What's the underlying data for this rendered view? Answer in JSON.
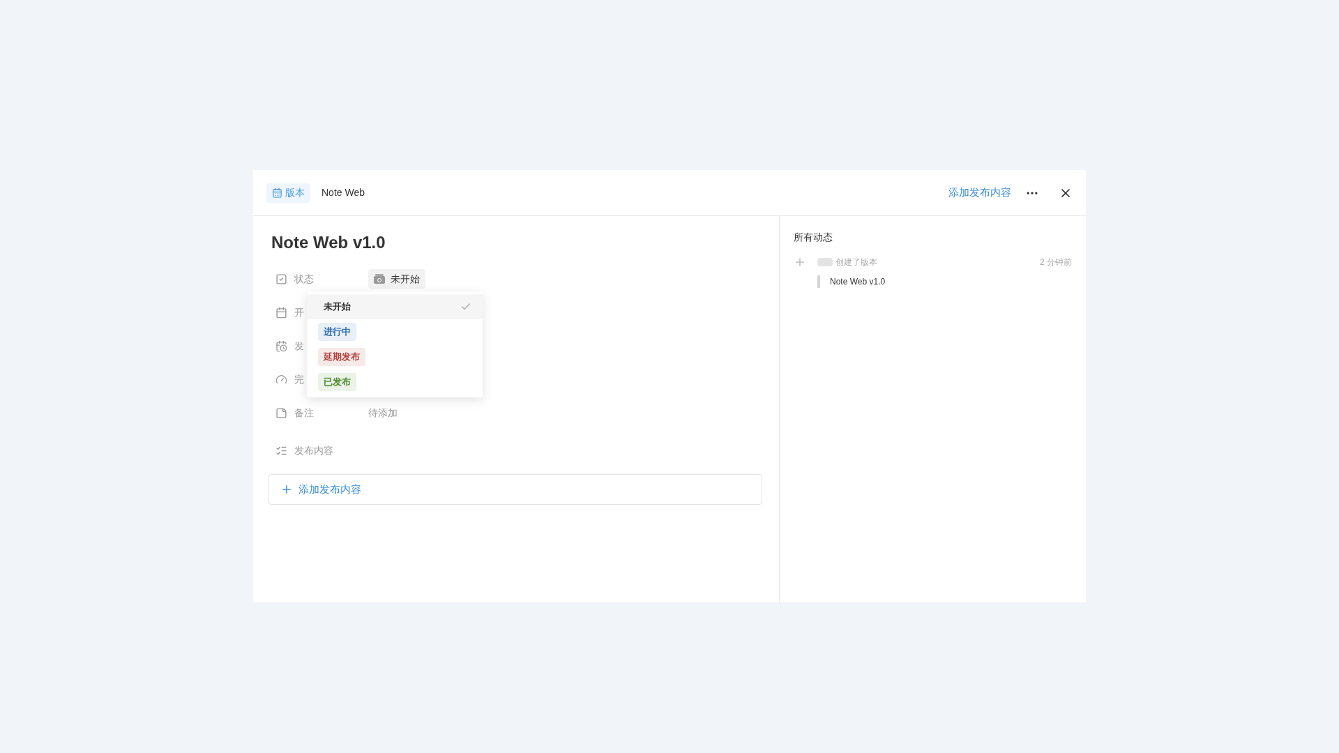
{
  "header": {
    "type_tag": "版本",
    "project": "Note Web",
    "add_button": "添加发布内容"
  },
  "title": "Note Web v1.0",
  "properties": [
    {
      "kind": "status",
      "label": "状态",
      "value": "未开始"
    },
    {
      "kind": "date",
      "label": "开"
    },
    {
      "kind": "date-due",
      "label": "发"
    },
    {
      "kind": "progress",
      "label": "完"
    },
    {
      "kind": "note",
      "label": "备注",
      "placeholder": "待添加"
    },
    {
      "kind": "list",
      "label": "发布内容"
    }
  ],
  "status_menu": [
    {
      "label": "未开始",
      "color": "#333333",
      "selected": true
    },
    {
      "label": "进行中",
      "color": "#2f6fb0",
      "selected": false
    },
    {
      "label": "延期发布",
      "color": "#b0423a",
      "selected": false
    },
    {
      "label": "已发布",
      "color": "#4a8a2e",
      "selected": false
    }
  ],
  "add_content": "添加发布内容",
  "activity": {
    "title": "所有动态",
    "items": [
      {
        "action": "创建了版本",
        "time": "2 分钟前",
        "detail": "Note Web v1.0"
      }
    ]
  }
}
